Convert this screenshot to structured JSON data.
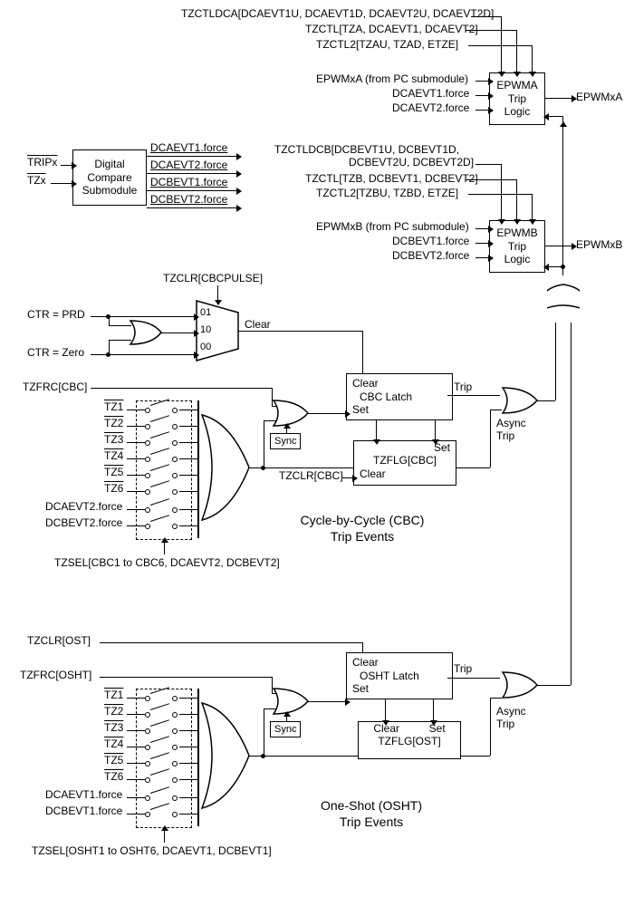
{
  "dc_submodule": {
    "title_l1": "Digital",
    "title_l2": "Compare",
    "title_l3": "Submodule",
    "in_tripx": "TRIPx",
    "in_tzx": "TZx",
    "out1": "DCAEVT1.force",
    "out2": "DCAEVT2.force",
    "out3": "DCBEVT1.force",
    "out4": "DCBEVT2.force"
  },
  "epwma": {
    "title_l1": "EPWMA",
    "title_l2": "Trip",
    "title_l3": "Logic",
    "reg1": "TZCTLDCA[DCAEVT1U, DCAEVT1D, DCAEVT2U, DCAEVT2D]",
    "reg2": "TZCTL[TZA, DCAEVT1, DCAEVT2]",
    "reg3": "TZCTL2[TZAU, TZAD, ETZE]",
    "in_epwm": "EPWMxA (from PC submodule)",
    "in_force1": "DCAEVT1.force",
    "in_force2": "DCAEVT2.force",
    "out": "EPWMxA"
  },
  "epwmb": {
    "title_l1": "EPWMB",
    "title_l2": "Trip",
    "title_l3": "Logic",
    "reg1": "TZCTLDCB[DCBEVT1U, DCBEVT1D,",
    "reg1b": "DCBEVT2U, DCBEVT2D]",
    "reg2": "TZCTL[TZB, DCBEVT1, DCBEVT2]",
    "reg3": "TZCTL2[TZBU, TZBD, ETZE]",
    "in_epwm": "EPWMxB (from PC submodule)",
    "in_force1": "DCBEVT1.force",
    "in_force2": "DCBEVT2.force",
    "out": "EPWMxB"
  },
  "mux": {
    "tzclr": "TZCLR[CBCPULSE]",
    "in_prd": "CTR = PRD",
    "in_zero": "CTR = Zero",
    "opt01": "01",
    "opt10": "10",
    "opt00": "00",
    "out": "Clear"
  },
  "cbc": {
    "title_l1": "Cycle-by-Cycle (CBC)",
    "title_l2": "Trip Events",
    "tzfrc": "TZFRC[CBC]",
    "sync": "Sync",
    "latch_l1": "Clear",
    "latch_l2": "CBC Latch",
    "latch_l3": "Set",
    "trip": "Trip",
    "async": "Async",
    "async2": "Trip",
    "flag_set": "Set",
    "flag_name": "TZFLG[CBC]",
    "flag_clear": "Clear",
    "tzclr": "TZCLR[CBC]",
    "tz1": "TZ1",
    "tz2": "TZ2",
    "tz3": "TZ3",
    "tz4": "TZ4",
    "tz5": "TZ5",
    "tz6": "TZ6",
    "dca": "DCAEVT2.force",
    "dcb": "DCBEVT2.force",
    "tzsel": "TZSEL[CBC1 to CBC6, DCAEVT2, DCBEVT2]"
  },
  "osht": {
    "title_l1": "One-Shot (OSHT)",
    "title_l2": "Trip Events",
    "tzclr": "TZCLR[OST]",
    "tzfrc": "TZFRC[OSHT]",
    "sync": "Sync",
    "latch_l1": "Clear",
    "latch_l2": "OSHT Latch",
    "latch_l3": "Set",
    "trip": "Trip",
    "async": "Async",
    "async2": "Trip",
    "flag_clear": "Clear",
    "flag_set": "Set",
    "flag_name": "TZFLG[OST]",
    "tz1": "TZ1",
    "tz2": "TZ2",
    "tz3": "TZ3",
    "tz4": "TZ4",
    "tz5": "TZ5",
    "tz6": "TZ6",
    "dca": "DCAEVT1.force",
    "dcb": "DCBEVT1.force",
    "tzsel": "TZSEL[OSHT1 to OSHT6, DCAEVT1, DCBEVT1]"
  }
}
